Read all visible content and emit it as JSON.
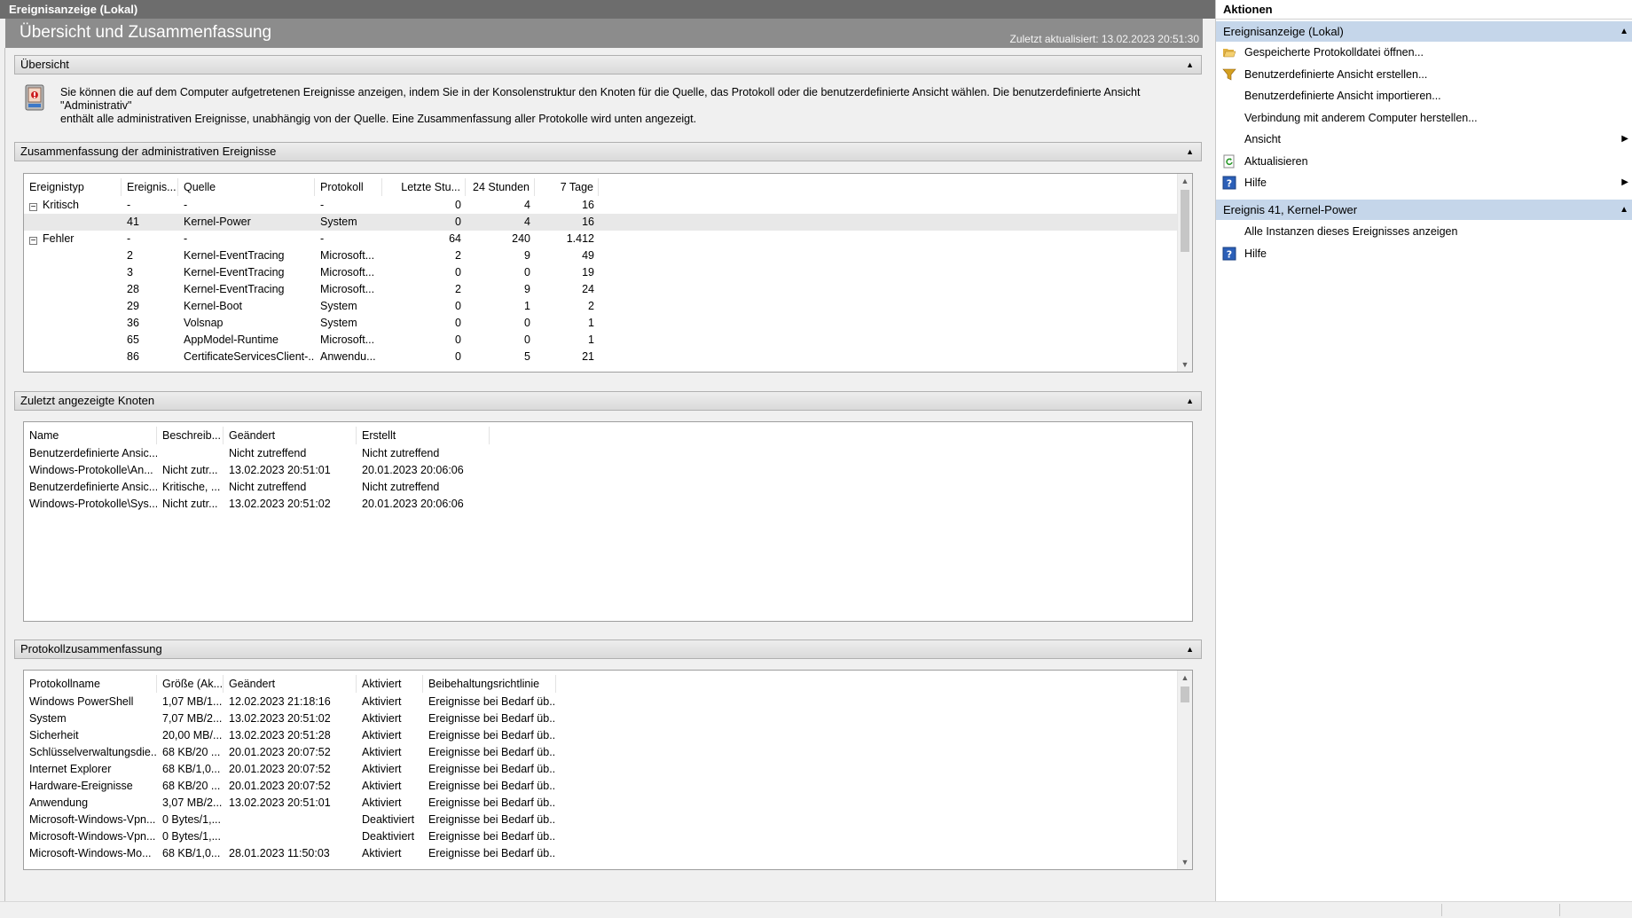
{
  "window": {
    "title": "Ereignisanzeige (Lokal)"
  },
  "page": {
    "title": "Übersicht und Zusammenfassung",
    "updated": "Zuletzt aktualisiert: 13.02.2023 20:51:30"
  },
  "overview": {
    "header": "Übersicht",
    "collapse": "▲",
    "text_line1": "Sie können die auf dem Computer aufgetretenen Ereignisse anzeigen, indem Sie in der Konsolenstruktur den Knoten für die Quelle, das Protokoll oder die benutzerdefinierte Ansicht wählen. Die benutzerdefinierte Ansicht \"Administrativ\"",
    "text_line2": "enthält alle administrativen Ereignisse, unabhängig von der Quelle. Eine Zusammenfassung aller Protokolle wird unten angezeigt.",
    "icon": "event-viewer-icon"
  },
  "admin_summary": {
    "header": "Zusammenfassung der administrativen Ereignisse",
    "collapse": "▲",
    "columns": [
      "Ereignistyp",
      "Ereignis...",
      "Quelle",
      "Protokoll",
      "Letzte Stu...",
      "24 Stunden",
      "7 Tage"
    ],
    "rows": [
      [
        "Kritisch",
        "-",
        "-",
        "-",
        "0",
        "4",
        "16"
      ],
      [
        "",
        "41",
        "Kernel-Power",
        "System",
        "0",
        "4",
        "16"
      ],
      [
        "Fehler",
        "-",
        "-",
        "-",
        "64",
        "240",
        "1.412"
      ],
      [
        "",
        "2",
        "Kernel-EventTracing",
        "Microsoft...",
        "2",
        "9",
        "49"
      ],
      [
        "",
        "3",
        "Kernel-EventTracing",
        "Microsoft...",
        "0",
        "0",
        "19"
      ],
      [
        "",
        "28",
        "Kernel-EventTracing",
        "Microsoft...",
        "2",
        "9",
        "24"
      ],
      [
        "",
        "29",
        "Kernel-Boot",
        "System",
        "0",
        "1",
        "2"
      ],
      [
        "",
        "36",
        "Volsnap",
        "System",
        "0",
        "0",
        "1"
      ],
      [
        "",
        "65",
        "AppModel-Runtime",
        "Microsoft...",
        "0",
        "0",
        "1"
      ],
      [
        "",
        "86",
        "CertificateServicesClient-...",
        "Anwendu...",
        "0",
        "5",
        "21"
      ]
    ],
    "expander": "−"
  },
  "recent_nodes": {
    "header": "Zuletzt angezeigte Knoten",
    "collapse": "▲",
    "columns": [
      "Name",
      "Beschreib...",
      "Geändert",
      "Erstellt"
    ],
    "rows": [
      [
        "Benutzerdefinierte Ansic...",
        "",
        "Nicht zutreffend",
        "Nicht zutreffend"
      ],
      [
        "Windows-Protokolle\\An...",
        "Nicht zutr...",
        "13.02.2023 20:51:01",
        "20.01.2023 20:06:06"
      ],
      [
        "Benutzerdefinierte Ansic...",
        "Kritische, ...",
        "Nicht zutreffend",
        "Nicht zutreffend"
      ],
      [
        "Windows-Protokolle\\Sys...",
        "Nicht zutr...",
        "13.02.2023 20:51:02",
        "20.01.2023 20:06:06"
      ]
    ]
  },
  "log_summary": {
    "header": "Protokollzusammenfassung",
    "collapse": "▲",
    "columns": [
      "Protokollname",
      "Größe (Ak...",
      "Geändert",
      "Aktiviert",
      "Beibehaltungsrichtlinie"
    ],
    "rows": [
      [
        "Windows PowerShell",
        "1,07 MB/1...",
        "12.02.2023 21:18:16",
        "Aktiviert",
        "Ereignisse bei Bedarf üb..."
      ],
      [
        "System",
        "7,07 MB/2...",
        "13.02.2023 20:51:02",
        "Aktiviert",
        "Ereignisse bei Bedarf üb..."
      ],
      [
        "Sicherheit",
        "20,00 MB/...",
        "13.02.2023 20:51:28",
        "Aktiviert",
        "Ereignisse bei Bedarf üb..."
      ],
      [
        "Schlüsselverwaltungsdie...",
        "68 KB/20 ...",
        "20.01.2023 20:07:52",
        "Aktiviert",
        "Ereignisse bei Bedarf üb..."
      ],
      [
        "Internet Explorer",
        "68 KB/1,0...",
        "20.01.2023 20:07:52",
        "Aktiviert",
        "Ereignisse bei Bedarf üb..."
      ],
      [
        "Hardware-Ereignisse",
        "68 KB/20 ...",
        "20.01.2023 20:07:52",
        "Aktiviert",
        "Ereignisse bei Bedarf üb..."
      ],
      [
        "Anwendung",
        "3,07 MB/2...",
        "13.02.2023 20:51:01",
        "Aktiviert",
        "Ereignisse bei Bedarf üb..."
      ],
      [
        "Microsoft-Windows-Vpn...",
        "0 Bytes/1,...",
        "",
        "Deaktiviert",
        "Ereignisse bei Bedarf üb..."
      ],
      [
        "Microsoft-Windows-Vpn...",
        "0 Bytes/1,...",
        "",
        "Deaktiviert",
        "Ereignisse bei Bedarf üb..."
      ],
      [
        "Microsoft-Windows-Mo...",
        "68 KB/1,0...",
        "28.01.2023 11:50:03",
        "Aktiviert",
        "Ereignisse bei Bedarf üb..."
      ]
    ]
  },
  "scroll": {
    "up": "▲",
    "down": "▼"
  },
  "actions": {
    "title": "Aktionen",
    "group1": {
      "label": "Ereignisanzeige (Lokal)",
      "caret": "▲"
    },
    "group1_items": [
      {
        "label": "Gespeicherte Protokolldatei öffnen...",
        "icon": "folder-open-icon"
      },
      {
        "label": "Benutzerdefinierte Ansicht erstellen...",
        "icon": "filter-funnel-icon"
      },
      {
        "label": "Benutzerdefinierte Ansicht importieren...",
        "icon": ""
      },
      {
        "label": "Verbindung mit anderem Computer herstellen...",
        "icon": ""
      },
      {
        "label": "Ansicht",
        "icon": "",
        "submenu": "▶"
      },
      {
        "label": "Aktualisieren",
        "icon": "refresh-icon"
      },
      {
        "label": "Hilfe",
        "icon": "help-icon",
        "submenu": "▶"
      }
    ],
    "group2": {
      "label": "Ereignis 41, Kernel-Power",
      "caret": "▲"
    },
    "group2_items": [
      {
        "label": "Alle Instanzen dieses Ereignisses anzeigen",
        "icon": ""
      },
      {
        "label": "Hilfe",
        "icon": "help-icon"
      }
    ]
  },
  "colors": {
    "header_gray": "#8c8c8c",
    "group_blue": "#c5d6ea",
    "selected_row": "#e8e8e8"
  }
}
